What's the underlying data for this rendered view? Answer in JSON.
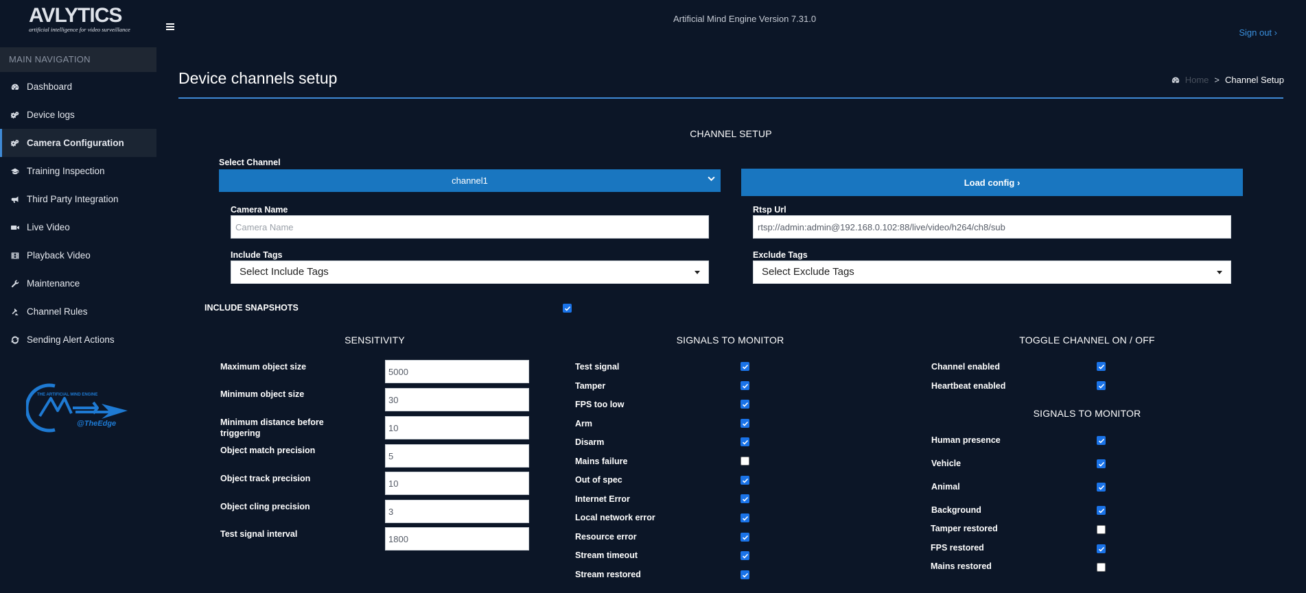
{
  "brand": {
    "logo_text": "AVLYTICS",
    "logo_tagline": "artificial intelligence for video surveillance",
    "ame_logo_text": "THE ARTIFICIAL MIND ENGINE",
    "ame_logo_sub": "@TheEdge"
  },
  "header": {
    "engine_version": "Artificial Mind Engine Version 7.31.0",
    "signout_label": "Sign out ›"
  },
  "sidebar": {
    "header": "MAIN NAVIGATION",
    "items": [
      {
        "label": "Dashboard",
        "icon": "dashboard-icon"
      },
      {
        "label": "Device logs",
        "icon": "gears-icon"
      },
      {
        "label": "Camera Configuration",
        "icon": "gears-icon",
        "active": true
      },
      {
        "label": "Training Inspection",
        "icon": "graduation-cap-icon"
      },
      {
        "label": "Third Party Integration",
        "icon": "bullhorn-icon"
      },
      {
        "label": "Live Video",
        "icon": "video-camera-icon"
      },
      {
        "label": "Playback Video",
        "icon": "film-icon"
      },
      {
        "label": "Maintenance",
        "icon": "wrench-icon"
      },
      {
        "label": "Channel Rules",
        "icon": "gavel-icon"
      },
      {
        "label": "Sending Alert Actions",
        "icon": "refresh-icon"
      }
    ]
  },
  "page": {
    "title": "Device channels setup",
    "breadcrumb_home": "Home",
    "breadcrumb_sep": ">",
    "breadcrumb_current": "Channel Setup"
  },
  "channel_setup": {
    "title": "CHANNEL SETUP",
    "select_channel_label": "Select Channel",
    "selected_channel": "channel1",
    "load_config_label": "Load config ›",
    "camera_name_label": "Camera Name",
    "camera_name_value": "",
    "camera_name_placeholder": "Camera Name",
    "rtsp_label": "Rtsp Url",
    "rtsp_value": "rtsp://admin:admin@192.168.0.102:88/live/video/h264/ch8/sub",
    "include_tags_label": "Include Tags",
    "include_tags_value": "Select Include Tags",
    "exclude_tags_label": "Exclude Tags",
    "exclude_tags_value": "Select Exclude Tags",
    "include_snapshots_label": "INCLUDE SNAPSHOTS",
    "include_snapshots_checked": true
  },
  "sensitivity": {
    "title": "SENSITIVITY",
    "rows": [
      {
        "label": "Maximum object size",
        "value": "5000"
      },
      {
        "label": "Minimum object size",
        "value": "30"
      },
      {
        "label": "Minimum distance before triggering",
        "value": "10"
      },
      {
        "label": "Object match precision",
        "value": "5"
      },
      {
        "label": "Object track precision",
        "value": "10"
      },
      {
        "label": "Object cling precision",
        "value": "3"
      },
      {
        "label": "Test signal interval",
        "value": "1800"
      }
    ]
  },
  "signals_middle": {
    "title": "SIGNALS TO MONITOR",
    "rows": [
      {
        "label": "Test signal",
        "checked": true
      },
      {
        "label": "Tamper",
        "checked": true
      },
      {
        "label": "FPS too low",
        "checked": true
      },
      {
        "label": "Arm",
        "checked": true
      },
      {
        "label": "Disarm",
        "checked": true
      },
      {
        "label": "Mains failure",
        "checked": false
      },
      {
        "label": "Out of spec",
        "checked": true
      },
      {
        "label": "Internet Error",
        "checked": true
      },
      {
        "label": "Local network error",
        "checked": true
      },
      {
        "label": "Resource error",
        "checked": true
      },
      {
        "label": "Stream timeout",
        "checked": true
      },
      {
        "label": "Stream restored",
        "checked": true
      }
    ]
  },
  "toggle_channel": {
    "title": "TOGGLE CHANNEL ON / OFF",
    "rows": [
      {
        "label": "Channel enabled",
        "checked": true
      },
      {
        "label": "Heartbeat enabled",
        "checked": true
      }
    ]
  },
  "signals_right": {
    "title": "SIGNALS TO MONITOR",
    "rows": [
      {
        "label": "Human presence",
        "checked": true
      },
      {
        "label": "Vehicle",
        "checked": true
      },
      {
        "label": "Animal",
        "checked": true
      },
      {
        "label": "Background",
        "checked": true
      },
      {
        "label": "Tamper restored",
        "checked": false
      },
      {
        "label": "FPS restored",
        "checked": true
      },
      {
        "label": "Mains restored",
        "checked": false
      }
    ]
  },
  "colors": {
    "background": "#0c1627",
    "accent": "#1976c0",
    "rule": "#3f8ad6",
    "link": "#3a8fdc",
    "checkbox": "#1a73e8"
  }
}
